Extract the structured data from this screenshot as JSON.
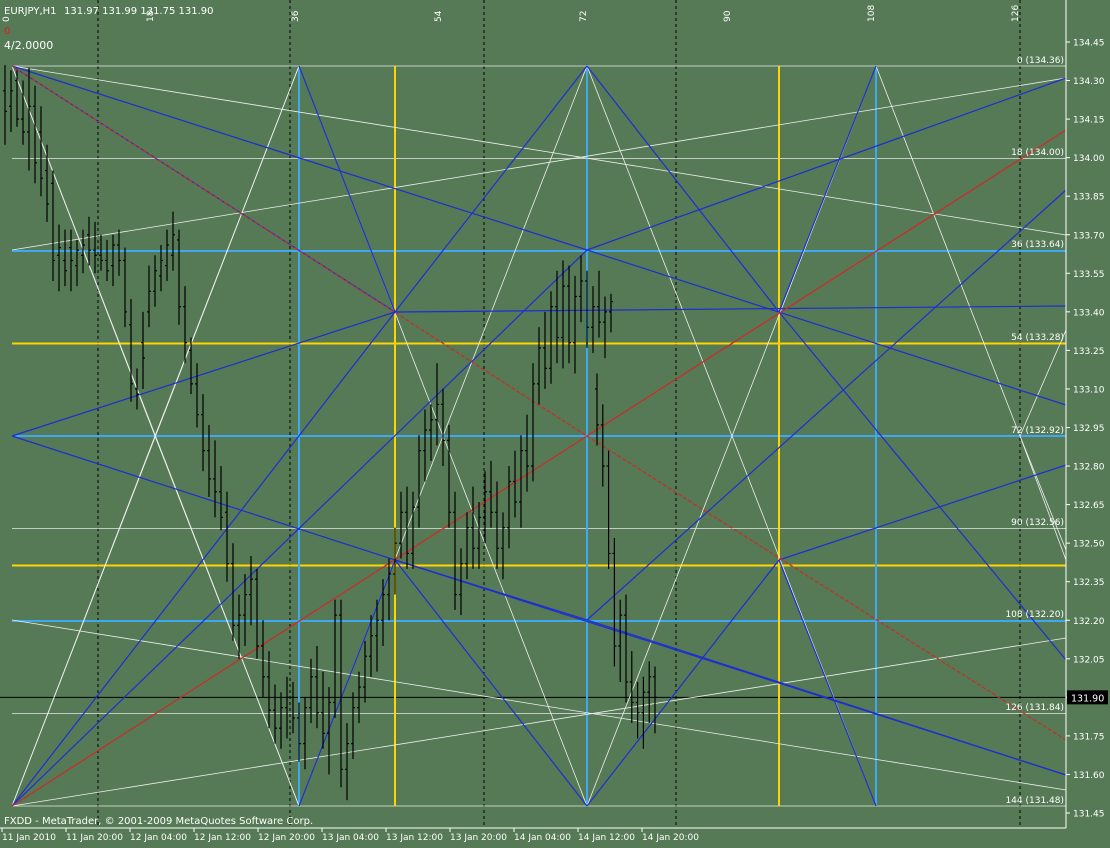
{
  "header": {
    "symbol_tf": "EURJPY,H1",
    "ohlc": "131.97 131.99 131.75 131.90",
    "indicator_value": "4/2.0000",
    "indicator_mark": "0"
  },
  "footer": {
    "copyright": "FXDD - MetaTrader, © 2001-2009 MetaQuotes Software Corp."
  },
  "colors": {
    "background": "#567a56",
    "text": "#ffffff",
    "candles": "#000000",
    "gann_light_blue": "#3fa8f0",
    "gann_blue": "#1d2fd0",
    "gann_yellow": "#ffd400",
    "gann_red": "#c4302a",
    "gann_white": "#ffffff"
  },
  "chart_data": {
    "type": "candlestick",
    "symbol": "EURJPY",
    "timeframe": "H1",
    "y_axis_ticks": [
      "134.45",
      "134.30",
      "134.15",
      "134.00",
      "133.85",
      "133.70",
      "133.55",
      "133.40",
      "133.25",
      "133.10",
      "132.95",
      "132.80",
      "132.65",
      "132.50",
      "132.35",
      "132.20",
      "132.05",
      "131.90",
      "131.75",
      "131.60",
      "131.45"
    ],
    "y_range": [
      131.45,
      134.45
    ],
    "current_price": "131.90",
    "x_axis_ticks": [
      "11 Jan 2010",
      "11 Jan 20:00",
      "12 Jan 04:00",
      "12 Jan 12:00",
      "12 Jan 20:00",
      "13 Jan 04:00",
      "13 Jan 12:00",
      "13 Jan 20:00",
      "14 Jan 04:00",
      "14 Jan 12:00",
      "14 Jan 20:00"
    ],
    "top_cycle_labels": [
      "0",
      "18",
      "36",
      "54",
      "72",
      "90",
      "108",
      "126"
    ],
    "gann_levels": [
      {
        "step": "0",
        "price": "134.36",
        "label": "0 (134.36)"
      },
      {
        "step": "18",
        "price": "134.00",
        "label": "18 (134.00)"
      },
      {
        "step": "36",
        "price": "133.64",
        "label": "36 (133.64)"
      },
      {
        "step": "54",
        "price": "133.28",
        "label": "54 (133.28)"
      },
      {
        "step": "72",
        "price": "132.92",
        "label": "72 (132.92)"
      },
      {
        "step": "90",
        "price": "132.56",
        "label": "90 (132.56)"
      },
      {
        "step": "108",
        "price": "132.20",
        "label": "108 (132.20)"
      },
      {
        "step": "126",
        "price": "131.84",
        "label": "126 (131.84)"
      },
      {
        "step": "144",
        "price": "131.48",
        "label": "144 (131.48)"
      }
    ],
    "ohlc_bars": [
      [
        134.26,
        134.36,
        134.05,
        134.18
      ],
      [
        134.2,
        134.34,
        134.1,
        134.26
      ],
      [
        134.3,
        134.34,
        134.12,
        134.15
      ],
      [
        134.15,
        134.3,
        134.05,
        134.1
      ],
      [
        134.1,
        134.35,
        133.95,
        134.2
      ],
      [
        134.2,
        134.28,
        133.9,
        133.98
      ],
      [
        134.1,
        134.2,
        133.85,
        133.92
      ],
      [
        133.95,
        134.05,
        133.75,
        133.82
      ],
      [
        133.9,
        133.95,
        133.52,
        133.6
      ],
      [
        133.62,
        133.74,
        133.48,
        133.65
      ],
      [
        133.6,
        133.72,
        133.5,
        133.56
      ],
      [
        133.65,
        133.72,
        133.48,
        133.6
      ],
      [
        133.58,
        133.68,
        133.5,
        133.64
      ],
      [
        133.62,
        133.72,
        133.55,
        133.66
      ],
      [
        133.7,
        133.77,
        133.58,
        133.64
      ],
      [
        133.64,
        133.75,
        133.55,
        133.62
      ],
      [
        133.62,
        133.7,
        133.56,
        133.6
      ],
      [
        133.6,
        133.68,
        133.52,
        133.56
      ],
      [
        133.58,
        133.7,
        133.5,
        133.66
      ],
      [
        133.66,
        133.72,
        133.54,
        133.6
      ],
      [
        133.6,
        133.65,
        133.34,
        133.4
      ],
      [
        133.35,
        133.45,
        133.05,
        133.12
      ],
      [
        133.1,
        133.18,
        133.02,
        133.08
      ],
      [
        133.28,
        133.4,
        133.1,
        133.22
      ],
      [
        133.4,
        133.58,
        133.34,
        133.48
      ],
      [
        133.48,
        133.62,
        133.42,
        133.56
      ],
      [
        133.54,
        133.66,
        133.48,
        133.6
      ],
      [
        133.58,
        133.72,
        133.52,
        133.66
      ],
      [
        133.62,
        133.79,
        133.56,
        133.7
      ],
      [
        133.68,
        133.72,
        133.35,
        133.42
      ],
      [
        133.42,
        133.5,
        133.2,
        133.28
      ],
      [
        133.25,
        133.3,
        133.08,
        133.12
      ],
      [
        133.12,
        133.2,
        132.95,
        133.0
      ],
      [
        133.0,
        133.08,
        132.78,
        132.86
      ],
      [
        132.86,
        132.96,
        132.68,
        132.75
      ],
      [
        132.75,
        132.9,
        132.6,
        132.7
      ],
      [
        132.7,
        132.8,
        132.55,
        132.6
      ],
      [
        132.62,
        132.7,
        132.35,
        132.42
      ],
      [
        132.42,
        132.5,
        132.12,
        132.18
      ],
      [
        132.18,
        132.3,
        132.05,
        132.22
      ],
      [
        132.22,
        132.38,
        132.1,
        132.3
      ],
      [
        132.3,
        132.45,
        132.18,
        132.36
      ],
      [
        132.36,
        132.4,
        132.05,
        132.1
      ],
      [
        132.1,
        132.2,
        131.9,
        131.98
      ],
      [
        131.98,
        132.08,
        131.78,
        131.85
      ],
      [
        131.85,
        131.95,
        131.72,
        131.78
      ],
      [
        131.78,
        131.92,
        131.7,
        131.86
      ],
      [
        131.86,
        131.98,
        131.74,
        131.9
      ],
      [
        131.9,
        131.96,
        131.76,
        131.82
      ],
      [
        131.82,
        131.88,
        131.65,
        131.72
      ],
      [
        131.72,
        131.9,
        131.62,
        131.86
      ],
      [
        131.86,
        132.05,
        131.8,
        131.98
      ],
      [
        131.98,
        132.1,
        131.78,
        131.84
      ],
      [
        131.84,
        132.0,
        131.7,
        131.76
      ],
      [
        131.76,
        131.94,
        131.6,
        131.88
      ],
      [
        131.88,
        132.28,
        131.82,
        132.22
      ],
      [
        132.22,
        132.28,
        131.55,
        131.62
      ],
      [
        131.62,
        131.8,
        131.5,
        131.72
      ],
      [
        131.72,
        131.92,
        131.66,
        131.86
      ],
      [
        131.86,
        132.0,
        131.8,
        131.94
      ],
      [
        131.94,
        132.12,
        131.88,
        132.06
      ],
      [
        132.06,
        132.22,
        131.98,
        132.14
      ],
      [
        132.14,
        132.28,
        132.0,
        132.2
      ],
      [
        132.2,
        132.36,
        132.1,
        132.3
      ],
      [
        132.3,
        132.44,
        132.2,
        132.38
      ],
      [
        132.38,
        132.56,
        132.3,
        132.5
      ],
      [
        132.5,
        132.7,
        132.44,
        132.62
      ],
      [
        132.62,
        132.72,
        132.4,
        132.46
      ],
      [
        132.46,
        132.7,
        132.4,
        132.64
      ],
      [
        132.64,
        132.92,
        132.56,
        132.86
      ],
      [
        132.86,
        133.02,
        132.74,
        132.94
      ],
      [
        132.94,
        133.04,
        132.82,
        132.98
      ],
      [
        132.98,
        133.2,
        132.88,
        133.04
      ],
      [
        133.04,
        133.1,
        132.8,
        132.9
      ],
      [
        132.9,
        132.96,
        132.56,
        132.62
      ],
      [
        132.62,
        132.7,
        132.24,
        132.3
      ],
      [
        132.3,
        132.48,
        132.22,
        132.42
      ],
      [
        132.42,
        132.62,
        132.36,
        132.56
      ],
      [
        132.56,
        132.72,
        132.4,
        132.48
      ],
      [
        132.48,
        132.66,
        132.4,
        132.6
      ],
      [
        132.6,
        132.78,
        132.5,
        132.7
      ],
      [
        132.7,
        132.82,
        132.56,
        132.62
      ],
      [
        132.62,
        132.74,
        132.4,
        132.48
      ],
      [
        132.48,
        132.62,
        132.36,
        132.56
      ],
      [
        132.56,
        132.8,
        132.48,
        132.74
      ],
      [
        132.74,
        132.86,
        132.6,
        132.66
      ],
      [
        132.66,
        132.92,
        132.56,
        132.86
      ],
      [
        132.86,
        133.0,
        132.7,
        132.8
      ],
      [
        132.8,
        133.2,
        132.74,
        133.12
      ],
      [
        133.12,
        133.34,
        133.04,
        133.26
      ],
      [
        133.26,
        133.4,
        133.1,
        133.18
      ],
      [
        133.18,
        133.48,
        133.12,
        133.42
      ],
      [
        133.42,
        133.56,
        133.2,
        133.3
      ],
      [
        133.3,
        133.6,
        133.18,
        133.5
      ],
      [
        133.5,
        133.58,
        133.2,
        133.28
      ],
      [
        133.28,
        133.54,
        133.16,
        133.46
      ],
      [
        133.46,
        133.62,
        133.36,
        133.52
      ],
      [
        133.52,
        133.56,
        133.26,
        133.34
      ],
      [
        133.34,
        133.5,
        133.24,
        133.42
      ],
      [
        133.42,
        133.56,
        133.3,
        133.36
      ],
      [
        133.36,
        133.46,
        133.22,
        133.4
      ],
      [
        133.4,
        133.47,
        133.32,
        133.44
      ],
      [
        133.1,
        133.16,
        132.88,
        132.96
      ],
      [
        132.96,
        133.04,
        132.72,
        132.8
      ],
      [
        132.8,
        132.86,
        132.4,
        132.46
      ],
      [
        132.46,
        132.52,
        132.02,
        132.1
      ],
      [
        132.1,
        132.28,
        131.96,
        132.22
      ],
      [
        132.22,
        132.3,
        131.88,
        131.96
      ],
      [
        131.96,
        132.08,
        131.8,
        131.88
      ],
      [
        131.88,
        131.96,
        131.74,
        131.84
      ],
      [
        131.84,
        131.98,
        131.7,
        131.92
      ],
      [
        131.92,
        132.04,
        131.8,
        131.98
      ],
      [
        131.98,
        132.02,
        131.76,
        131.9
      ]
    ]
  }
}
